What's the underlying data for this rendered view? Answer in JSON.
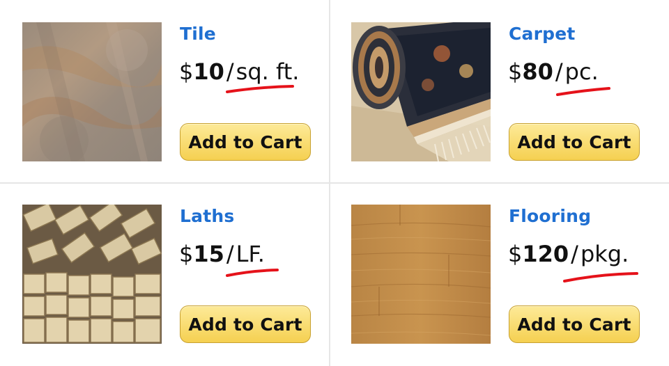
{
  "products": [
    {
      "name": "Tile",
      "currency": "$",
      "amount": "10",
      "separator": "/",
      "unit": "sq. ft.",
      "button_label": "Add to Cart",
      "image": "tile-image"
    },
    {
      "name": "Carpet",
      "currency": "$",
      "amount": "80",
      "separator": "/",
      "unit": "pc.",
      "button_label": "Add to Cart",
      "image": "carpet-image"
    },
    {
      "name": "Laths",
      "currency": "$",
      "amount": "15",
      "separator": "/",
      "unit": "LF.",
      "button_label": "Add to Cart",
      "image": "laths-image"
    },
    {
      "name": "Flooring",
      "currency": "$",
      "amount": "120",
      "separator": "/",
      "unit": "pkg.",
      "button_label": "Add to Cart",
      "image": "flooring-image"
    }
  ],
  "colors": {
    "product_name": "#1f6fd1",
    "button_fill": "#f5d051",
    "annotation_underline": "#e5121a"
  }
}
